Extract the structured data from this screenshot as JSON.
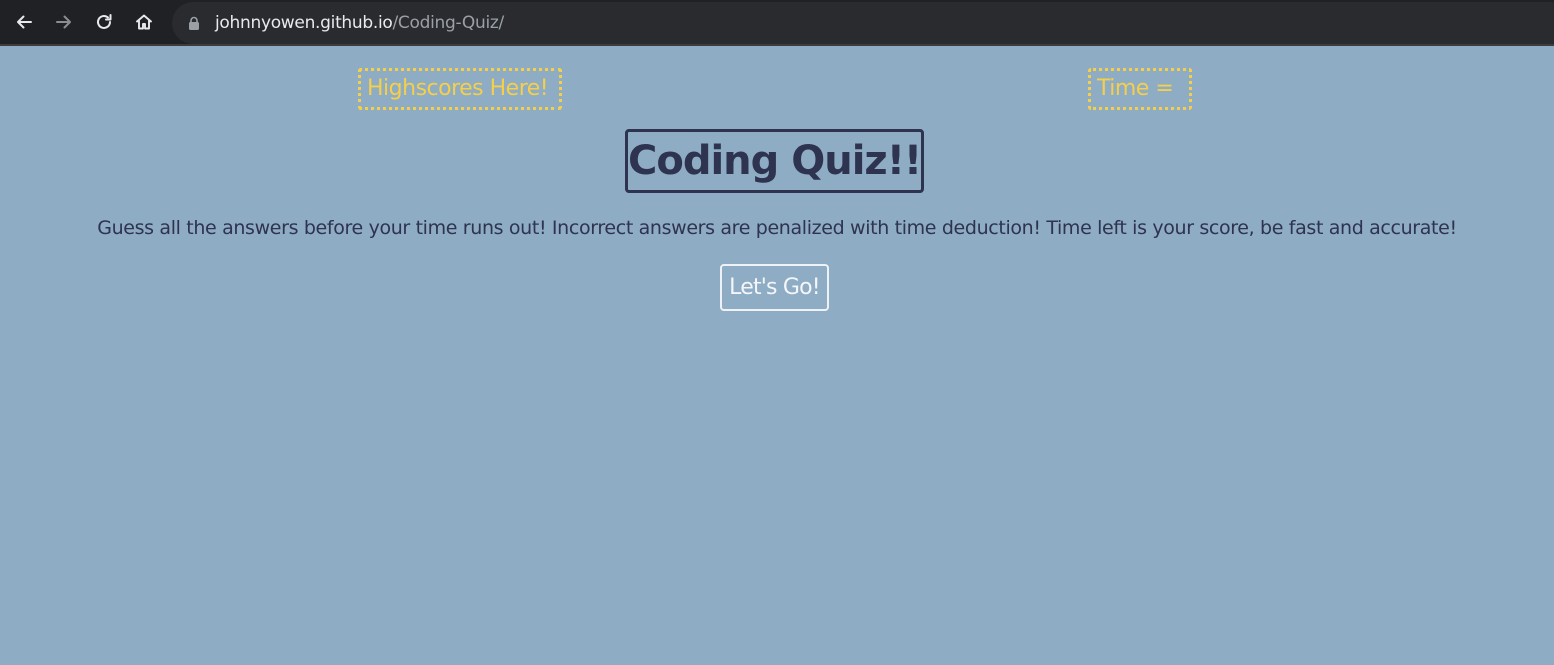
{
  "browser": {
    "url_host": "johnnyowen.github.io",
    "url_path": "/Coding-Quiz/"
  },
  "header": {
    "highscores_label": "Highscores Here!",
    "timer_label": "Time = "
  },
  "main": {
    "title": "Coding Quiz!!",
    "instructions": "Guess all the answers before your time runs out! Incorrect answers are penalized with time deduction! Time left is your score, be fast and accurate!",
    "start_button_label": "Let's Go!"
  },
  "colors": {
    "page_background": "#8eacc4",
    "accent_yellow": "#f5cf4a",
    "text_dark": "#2e3350",
    "browser_bar": "#202124"
  },
  "icons": {
    "back": "back-arrow-icon",
    "forward": "forward-arrow-icon",
    "reload": "reload-icon",
    "home": "home-icon",
    "lock": "lock-icon"
  }
}
